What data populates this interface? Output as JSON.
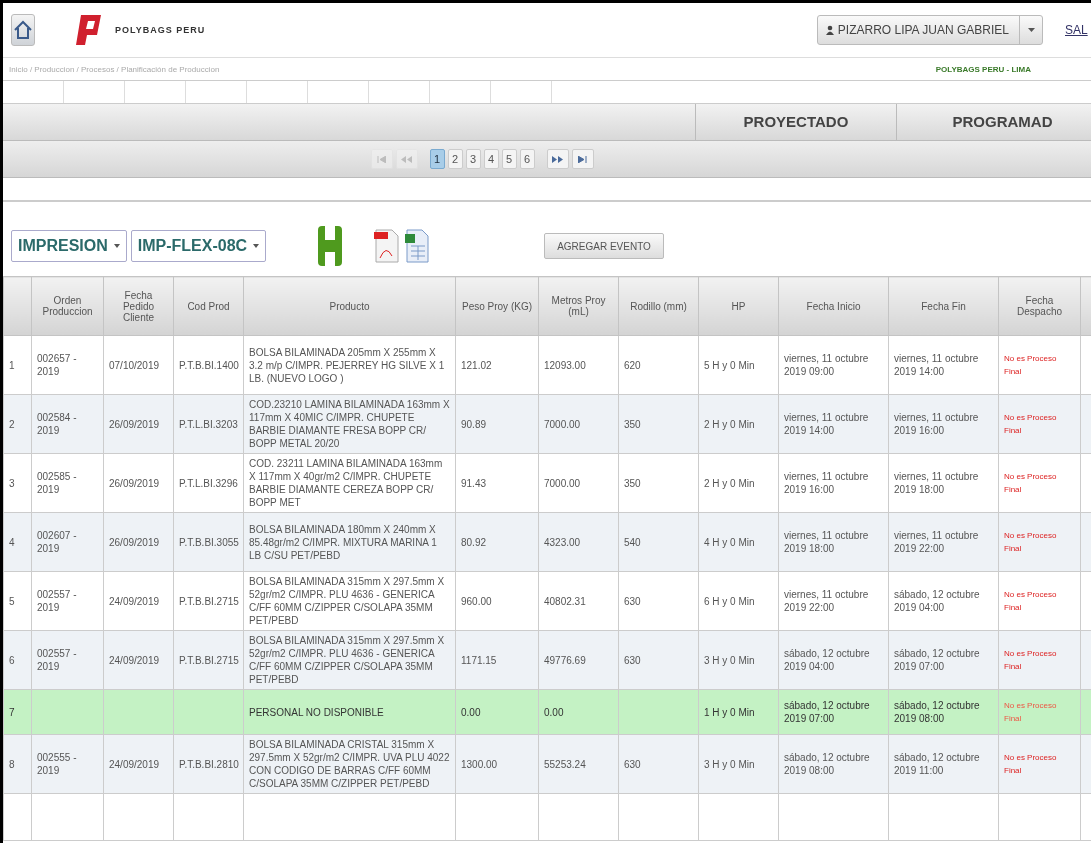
{
  "header": {
    "brand": "POLYBAGS PERU",
    "user": "PIZARRO LIPA JUAN GABRIEL",
    "logout": "SAL"
  },
  "breadcrumb": "Inicio / Produccion / Procesos / Planificación de Produccion",
  "site": "POLYBAGS PERU - LIMA",
  "band": {
    "groups": [
      "PROYECTADO",
      "PROGRAMAD"
    ]
  },
  "pager": {
    "first_disabled": true,
    "pages": [
      {
        "label": "1",
        "selected": true
      },
      {
        "label": "2",
        "selected": false
      },
      {
        "label": "3",
        "selected": false
      },
      {
        "label": "4",
        "selected": false
      },
      {
        "label": "5",
        "selected": false
      },
      {
        "label": "6",
        "selected": false
      }
    ]
  },
  "toolbar": {
    "process": "IMPRESION",
    "machine": "IMP-FLEX-08C",
    "add_event": "AGREGAR EVENTO"
  },
  "table": {
    "columns": [
      "",
      "Orden Produccion",
      "Fecha Pedido Cliente",
      "Cod Prod",
      "Producto",
      "Peso Proy (KG)",
      "Metros Proy (mL)",
      "Rodillo (mm)",
      "HP",
      "Fecha Inicio",
      "Fecha Fin",
      "Fecha Despacho"
    ],
    "rows": [
      {
        "kind": "order",
        "cells": [
          "1",
          "002657 - 2019",
          "07/10/2019",
          "P.T.B.BI.1400",
          "BOLSA BILAMINADA 205mm X 255mm X 3.2 m/p C/IMPR. PEJERREY HG SILVE X 1 LB. (NUEVO LOGO )",
          "121.02",
          "12093.00",
          "620",
          "5 H y 0 Min",
          "viernes, 11 octubre 2019 09:00",
          "viernes, 11 octubre 2019 14:00",
          "No es Proceso Final"
        ]
      },
      {
        "kind": "order",
        "cells": [
          "2",
          "002584 - 2019",
          "26/09/2019",
          "P.T.L.BI.3203",
          "COD.23210 LAMINA BILAMINADA 163mm X 117mm X 40MIC C/IMPR. CHUPETE BARBIE DIAMANTE FRESA BOPP CR/ BOPP METAL 20/20",
          "90.89",
          "7000.00",
          "350",
          "2 H y 0 Min",
          "viernes, 11 octubre 2019 14:00",
          "viernes, 11 octubre 2019 16:00",
          "No es Proceso Final"
        ]
      },
      {
        "kind": "order",
        "cells": [
          "3",
          "002585 - 2019",
          "26/09/2019",
          "P.T.L.BI.3296",
          "COD. 23211 LAMINA BILAMINADA 163mm X 117mm X 40gr/m2 C/IMPR. CHUPETE BARBIE DIAMANTE CEREZA BOPP CR/ BOPP MET",
          "91.43",
          "7000.00",
          "350",
          "2 H y 0 Min",
          "viernes, 11 octubre 2019 16:00",
          "viernes, 11 octubre 2019 18:00",
          "No es Proceso Final"
        ]
      },
      {
        "kind": "order",
        "cells": [
          "4",
          "002607 - 2019",
          "26/09/2019",
          "P.T.B.BI.3055",
          "BOLSA BILAMINADA 180mm X 240mm X 85.48gr/m2 C/IMPR. MIXTURA MARINA 1 LB C/SU PET/PEBD",
          "80.92",
          "4323.00",
          "540",
          "4 H y 0 Min",
          "viernes, 11 octubre 2019 18:00",
          "viernes, 11 octubre 2019 22:00",
          "No es Proceso Final"
        ]
      },
      {
        "kind": "order",
        "cells": [
          "5",
          "002557 - 2019",
          "24/09/2019",
          "P.T.B.BI.2715",
          "BOLSA BILAMINADA 315mm X 297.5mm X 52gr/m2 C/IMPR. PLU 4636 - GENERICA C/FF 60MM C/ZIPPER C/SOLAPA 35MM PET/PEBD",
          "960.00",
          "40802.31",
          "630",
          "6 H y 0 Min",
          "viernes, 11 octubre 2019 22:00",
          "sábado, 12 octubre 2019 04:00",
          "No es Proceso Final"
        ]
      },
      {
        "kind": "order",
        "cells": [
          "6",
          "002557 - 2019",
          "24/09/2019",
          "P.T.B.BI.2715",
          "BOLSA BILAMINADA 315mm X 297.5mm X 52gr/m2 C/IMPR. PLU 4636 - GENERICA C/FF 60MM C/ZIPPER C/SOLAPA 35MM PET/PEBD",
          "1171.15",
          "49776.69",
          "630",
          "3 H y 0 Min",
          "sábado, 12 octubre 2019 04:00",
          "sábado, 12 octubre 2019 07:00",
          "No es Proceso Final"
        ]
      },
      {
        "kind": "event",
        "cells": [
          "7",
          "",
          "",
          "",
          "PERSONAL NO DISPONIBLE",
          "0.00",
          "0.00",
          "",
          "1 H y 0 Min",
          "sábado, 12 octubre 2019 07:00",
          "sábado, 12 octubre 2019 08:00",
          "No es Proceso Final"
        ]
      },
      {
        "kind": "order",
        "cells": [
          "8",
          "002555 - 2019",
          "24/09/2019",
          "P.T.B.BI.2810",
          "BOLSA BILAMINADA CRISTAL 315mm X 297.5mm X 52gr/m2 C/IMPR. UVA PLU 4022 CON CODIGO DE BARRAS C/FF 60MM C/SOLAPA 35MM C/ZIPPER PET/PEBD",
          "1300.00",
          "55253.24",
          "630",
          "3 H y 0 Min",
          "sábado, 12 octubre 2019 08:00",
          "sábado, 12 octubre 2019 11:00",
          "No es Proceso Final"
        ]
      }
    ]
  }
}
